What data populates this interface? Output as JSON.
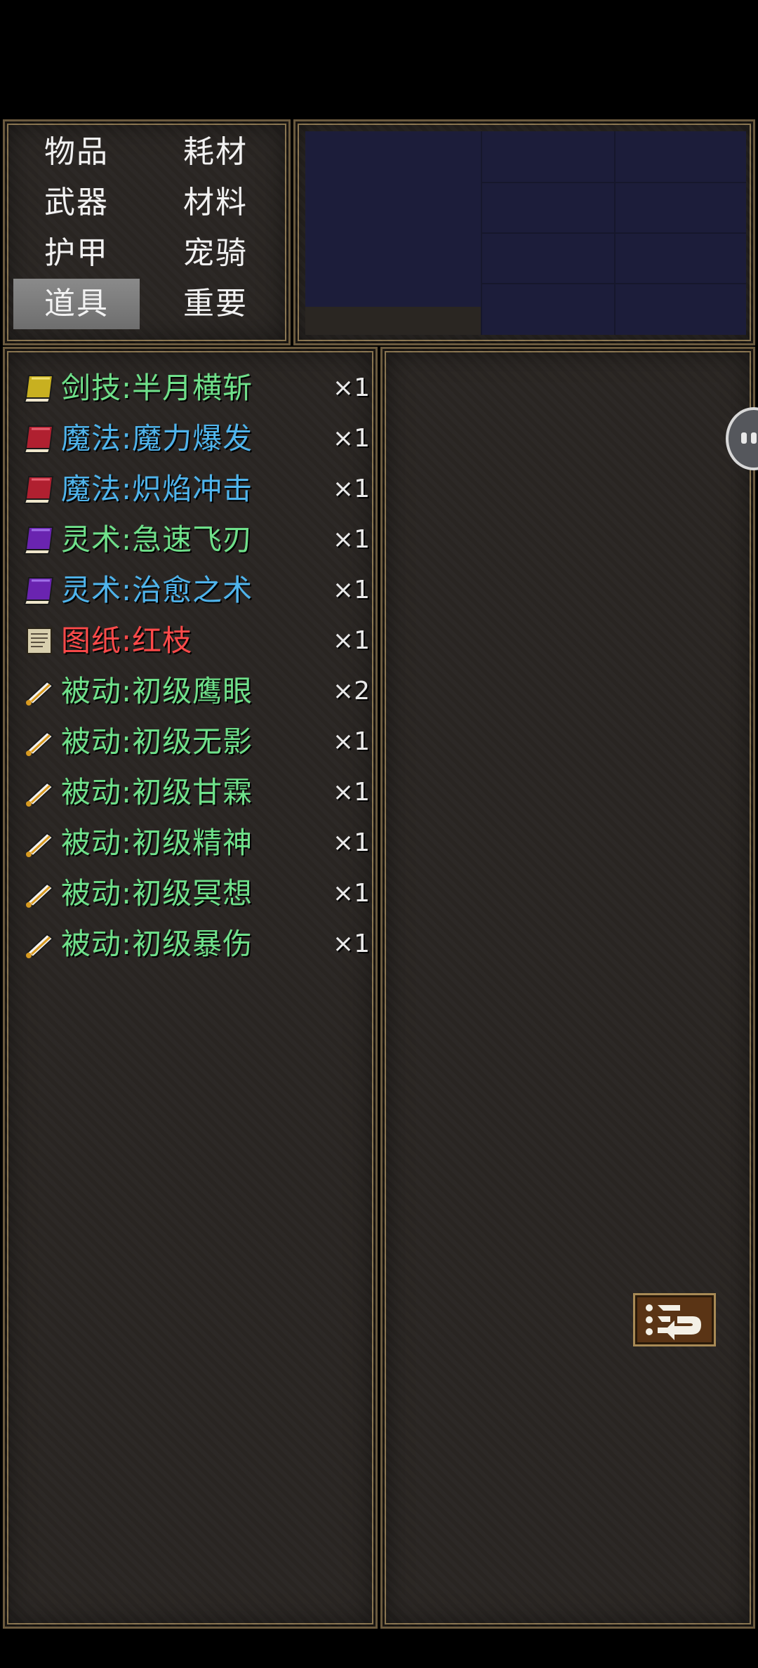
{
  "categories": {
    "items": [
      "物品",
      "耗材",
      "武器",
      "材料",
      "护甲",
      "宠骑",
      "道具",
      "重要"
    ],
    "active": "道具"
  },
  "inventory": [
    {
      "name": "剑技:半月横斩",
      "count": "×1",
      "color": "#6fe08a",
      "icon": "yellow-book-icon"
    },
    {
      "name": "魔法:魔力爆发",
      "count": "×1",
      "color": "#4fb4ec",
      "icon": "red-book-icon"
    },
    {
      "name": "魔法:炽焰冲击",
      "count": "×1",
      "color": "#4fb4ec",
      "icon": "red-book-icon"
    },
    {
      "name": "灵术:急速飞刃",
      "count": "×1",
      "color": "#6fe08a",
      "icon": "purple-book-icon"
    },
    {
      "name": "灵术:治愈之术",
      "count": "×1",
      "color": "#4fb4ec",
      "icon": "purple-book-icon"
    },
    {
      "name": "图纸:红枝",
      "count": "×1",
      "color": "#ff4a4a",
      "icon": "parchment-icon"
    },
    {
      "name": "被动:初级鹰眼",
      "count": "×2",
      "color": "#6fe08a",
      "icon": "scroll-icon"
    },
    {
      "name": "被动:初级无影",
      "count": "×1",
      "color": "#6fe08a",
      "icon": "scroll-icon"
    },
    {
      "name": "被动:初级甘霖",
      "count": "×1",
      "color": "#6fe08a",
      "icon": "scroll-icon"
    },
    {
      "name": "被动:初级精神",
      "count": "×1",
      "color": "#6fe08a",
      "icon": "scroll-icon"
    },
    {
      "name": "被动:初级冥想",
      "count": "×1",
      "color": "#6fe08a",
      "icon": "scroll-icon"
    },
    {
      "name": "被动:初级暴伤",
      "count": "×1",
      "color": "#6fe08a",
      "icon": "scroll-icon"
    }
  ],
  "colors": {
    "active_tab": "#7c7c7c",
    "frame": "#8a7550",
    "panel": "#2a2623",
    "preview": "#1c1d3a"
  },
  "buttons": {
    "return_icon": "return-list-icon",
    "float_icon": "floating-assistant-icon"
  }
}
